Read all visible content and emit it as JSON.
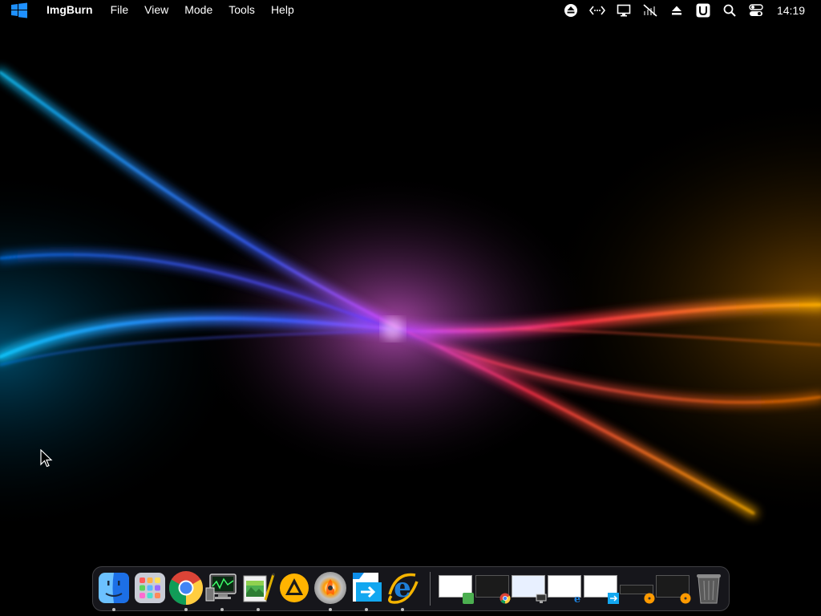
{
  "menubar": {
    "app_name": "ImgBurn",
    "menus": [
      "File",
      "View",
      "Mode",
      "Tools",
      "Help"
    ],
    "status_icons": [
      "eject-circle-icon",
      "remote-desktop-icon",
      "display-icon",
      "audio-muted-icon",
      "eject-icon",
      "u-box-icon",
      "search-icon",
      "control-center-icon"
    ],
    "clock": "14:19"
  },
  "dock": {
    "apps": [
      {
        "name": "finder-icon",
        "running": true
      },
      {
        "name": "launchpad-icon",
        "running": false
      },
      {
        "name": "chrome-icon",
        "running": true
      },
      {
        "name": "activity-monitor-icon",
        "running": true
      },
      {
        "name": "image-editor-icon",
        "running": true
      },
      {
        "name": "aimp-icon",
        "running": false
      },
      {
        "name": "imgburn-disc-icon",
        "running": true
      },
      {
        "name": "teamviewer-icon",
        "running": true
      },
      {
        "name": "internet-explorer-icon",
        "running": true
      }
    ],
    "windows": [
      {
        "name": "window-thumb-1",
        "badge": "green"
      },
      {
        "name": "window-thumb-2",
        "badge": "chrome"
      },
      {
        "name": "window-thumb-3",
        "badge": "monitor"
      },
      {
        "name": "window-thumb-4",
        "badge": "ie"
      },
      {
        "name": "window-thumb-5",
        "badge": "teamviewer"
      },
      {
        "name": "window-thumb-6",
        "badge": "disc"
      },
      {
        "name": "window-thumb-7",
        "badge": "disc"
      }
    ],
    "trash": "trash-icon"
  },
  "colors": {
    "menubar_bg": "#000000",
    "wallpaper_blue": "#1e6bff",
    "wallpaper_magenta": "#d24bff",
    "wallpaper_red": "#ff3a3a",
    "wallpaper_orange": "#ffb000"
  }
}
